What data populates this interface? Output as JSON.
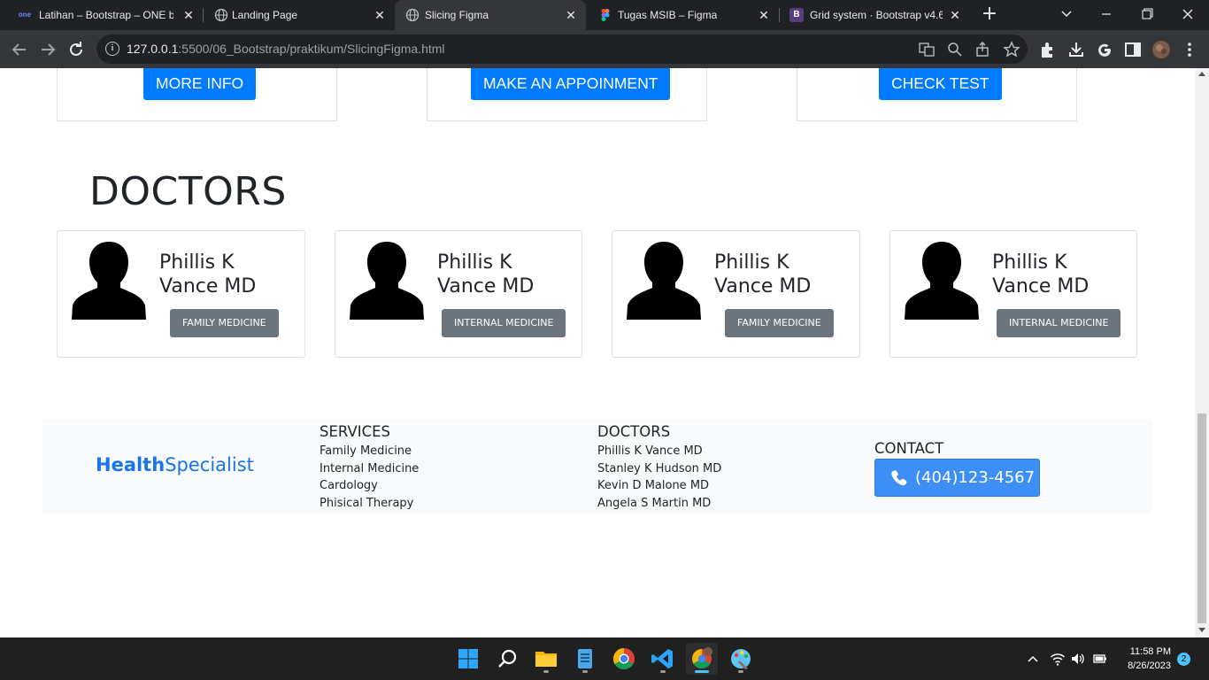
{
  "browser": {
    "tabs": [
      {
        "title": "Latihan – Bootstrap – ONE by",
        "icon": "one-logo-icon",
        "active": false
      },
      {
        "title": "Landing Page",
        "icon": "globe-icon",
        "active": false
      },
      {
        "title": "Slicing Figma",
        "icon": "globe-icon",
        "active": true
      },
      {
        "title": "Tugas MSIB – Figma",
        "icon": "figma-icon",
        "active": false
      },
      {
        "title": "Grid system · Bootstrap v4.6",
        "icon": "bootstrap-icon",
        "active": false
      }
    ],
    "url_host": "127.0.0.1",
    "url_path": ":5500/06_Bootstrap/praktikum/SlicingFigma.html"
  },
  "services": {
    "buttons": [
      "MORE INFO",
      "MAKE AN APPOINMENT",
      "CHECK TEST"
    ]
  },
  "doctors_section": {
    "title": "DOCTORS",
    "cards": [
      {
        "name": "Phillis K Vance MD",
        "specialty": "FAMILY MEDICINE"
      },
      {
        "name": "Phillis K Vance MD",
        "specialty": "INTERNAL MEDICINE"
      },
      {
        "name": "Phillis K Vance MD",
        "specialty": "FAMILY MEDICINE"
      },
      {
        "name": "Phillis K Vance MD",
        "specialty": "INTERNAL MEDICINE"
      }
    ]
  },
  "footer": {
    "brand_part1": "Health",
    "brand_part2": "Specialist",
    "services_heading": "SERVICES",
    "services": [
      "Family Medicine",
      "Internal Medicine",
      "Cardology",
      "Phisical Therapy"
    ],
    "doctors_heading": "DOCTORS",
    "doctors": [
      "Phillis K Vance MD",
      "Stanley K Hudson MD",
      "Kevin D Malone MD",
      "Angela S Martin MD"
    ],
    "contact_heading": "CONTACT",
    "phone": "(404)123-4567"
  },
  "taskbar": {
    "time": "11:58 PM",
    "date": "8/26/2023",
    "notifications": "2"
  },
  "colors": {
    "primary": "#007bff",
    "secondary": "#6c757d",
    "brand": "#1a73e8",
    "phone_button": "#3d8ef5"
  }
}
